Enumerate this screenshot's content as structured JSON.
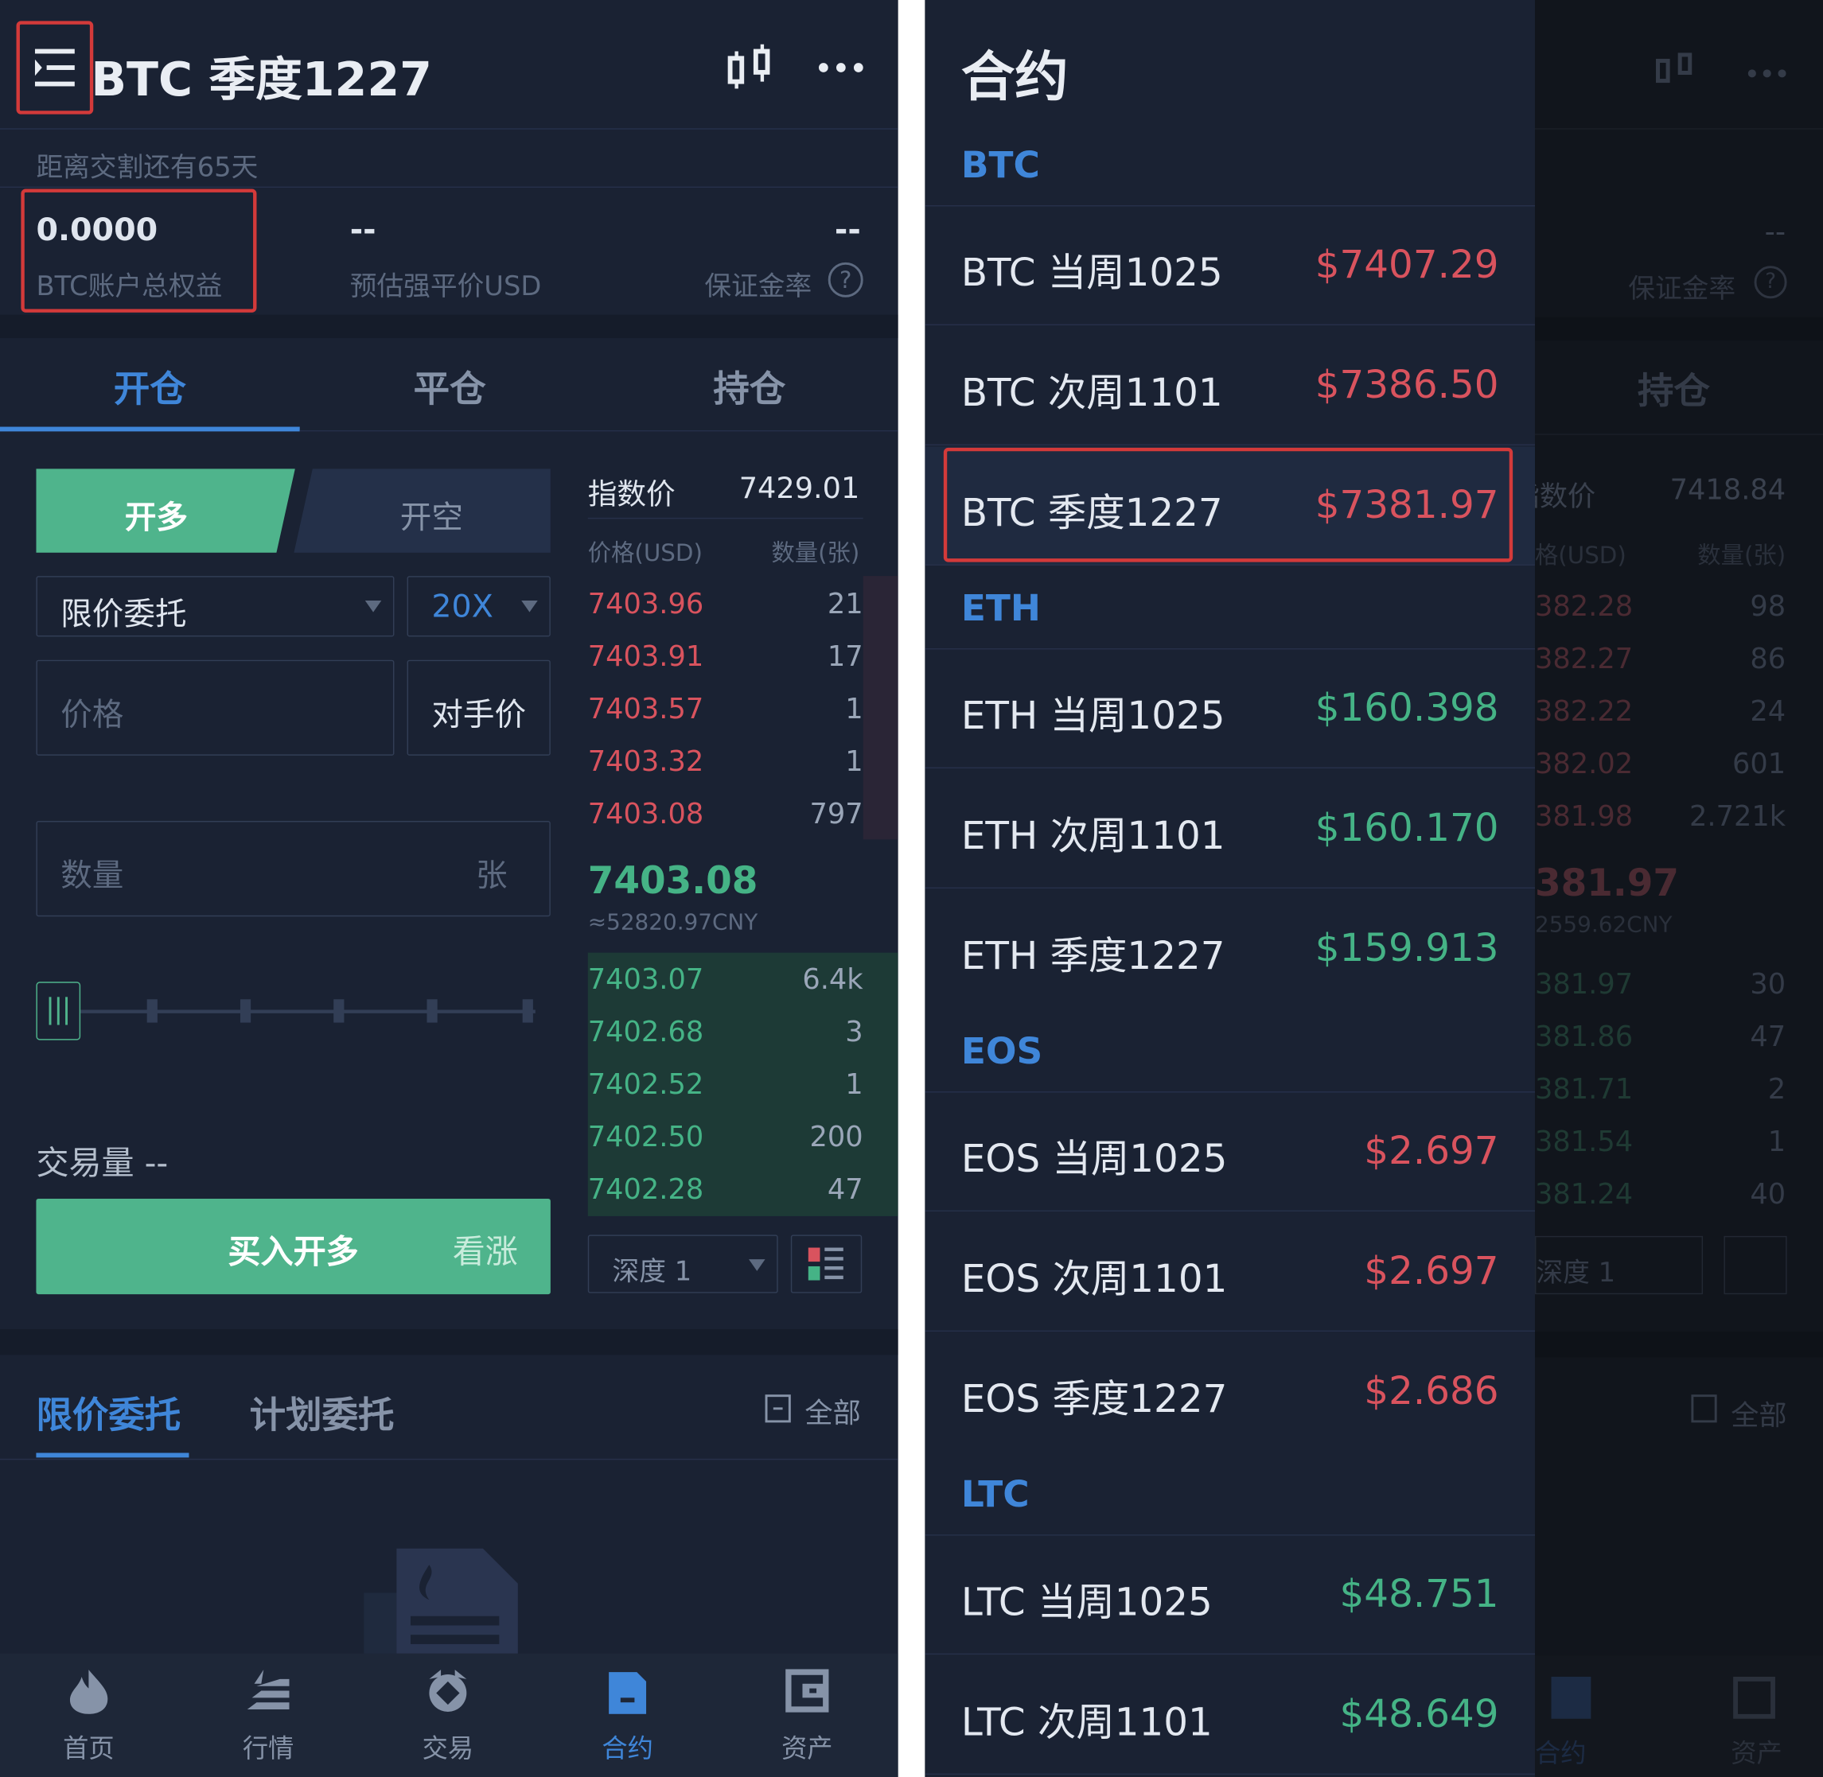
{
  "left": {
    "header": {
      "title": "BTC 季度1227",
      "chart_icon": "candlestick-icon",
      "more_icon": "more-dots-icon",
      "menu_icon": "menu-icon"
    },
    "delivery_note": "距离交割还有65天",
    "stats": [
      {
        "value": "0.0000",
        "label": "BTC账户总权益"
      },
      {
        "value": "--",
        "label": "预估强平价USD"
      },
      {
        "value": "--",
        "label": "保证金率"
      }
    ],
    "tabs": [
      "开仓",
      "平仓",
      "持仓"
    ],
    "side": {
      "long": "开多",
      "short": "开空"
    },
    "order_type": "限价委托",
    "leverage": "20X",
    "price_placeholder": "价格",
    "counterparty": "对手价",
    "qty_placeholder": "数量",
    "qty_unit": "张",
    "volume_label": "交易量 --",
    "buy_button": {
      "label": "买入开多",
      "hint": "看涨"
    },
    "orderbook": {
      "index_label": "指数价",
      "index_value": "7429.01",
      "price_header": "价格(USD)",
      "qty_header": "数量(张)",
      "asks": [
        {
          "p": "7403.96",
          "q": "21"
        },
        {
          "p": "7403.91",
          "q": "17"
        },
        {
          "p": "7403.57",
          "q": "1"
        },
        {
          "p": "7403.32",
          "q": "1"
        },
        {
          "p": "7403.08",
          "q": "797"
        }
      ],
      "last": "7403.08",
      "last_cny": "≈52820.97CNY",
      "bids": [
        {
          "p": "7403.07",
          "q": "6.4k"
        },
        {
          "p": "7402.68",
          "q": "3"
        },
        {
          "p": "7402.52",
          "q": "1"
        },
        {
          "p": "7402.50",
          "q": "200"
        },
        {
          "p": "7402.28",
          "q": "47"
        }
      ],
      "depth": "深度 1"
    },
    "order_tabs": [
      "限价委托",
      "计划委托"
    ],
    "all_label": "全部",
    "nav": [
      "首页",
      "行情",
      "交易",
      "合约",
      "资产"
    ]
  },
  "right": {
    "drawer_title": "合约",
    "groups": [
      {
        "name": "BTC",
        "items": [
          {
            "name": "BTC 当周1025",
            "price": "$7407.29",
            "color": "#d9535e"
          },
          {
            "name": "BTC 次周1101",
            "price": "$7386.50",
            "color": "#d9535e"
          },
          {
            "name": "BTC 季度1227",
            "price": "$7381.97",
            "color": "#d9535e"
          }
        ]
      },
      {
        "name": "ETH",
        "items": [
          {
            "name": "ETH 当周1025",
            "price": "$160.398",
            "color": "#45b386"
          },
          {
            "name": "ETH 次周1101",
            "price": "$160.170",
            "color": "#45b386"
          },
          {
            "name": "ETH 季度1227",
            "price": "$159.913",
            "color": "#45b386"
          }
        ]
      },
      {
        "name": "EOS",
        "items": [
          {
            "name": "EOS 当周1025",
            "price": "$2.697",
            "color": "#d9535e"
          },
          {
            "name": "EOS 次周1101",
            "price": "$2.697",
            "color": "#d9535e"
          },
          {
            "name": "EOS 季度1227",
            "price": "$2.686",
            "color": "#d9535e"
          }
        ]
      },
      {
        "name": "LTC",
        "items": [
          {
            "name": "LTC 当周1025",
            "price": "$48.751",
            "color": "#45b386"
          },
          {
            "name": "LTC 次周1101",
            "price": "$48.649",
            "color": "#45b386"
          }
        ]
      }
    ],
    "bg": {
      "stat_value": "--",
      "stat_label": "保证金率",
      "tab": "持仓",
      "index_label": "指数价",
      "index_value": "7418.84",
      "price_header": "格(USD)",
      "qty_header": "数量(张)",
      "asks": [
        {
          "p": "382.28",
          "q": "98"
        },
        {
          "p": "382.27",
          "q": "86"
        },
        {
          "p": "382.22",
          "q": "24"
        },
        {
          "p": "382.02",
          "q": "601"
        },
        {
          "p": "381.98",
          "q": "2.721k"
        }
      ],
      "last": "381.97",
      "last_cny": "2559.62CNY",
      "bids": [
        {
          "p": "381.97",
          "q": "30"
        },
        {
          "p": "381.86",
          "q": "47"
        },
        {
          "p": "381.71",
          "q": "2"
        },
        {
          "p": "381.54",
          "q": "1"
        },
        {
          "p": "381.24",
          "q": "40"
        }
      ],
      "depth": "深度 1",
      "all_label": "全部",
      "nav": [
        "合约",
        "资产"
      ]
    }
  },
  "colors": {
    "accent_blue": "#3f86d9",
    "red": "#d9535e",
    "green": "#45b386",
    "buy": "#4fb48c"
  }
}
